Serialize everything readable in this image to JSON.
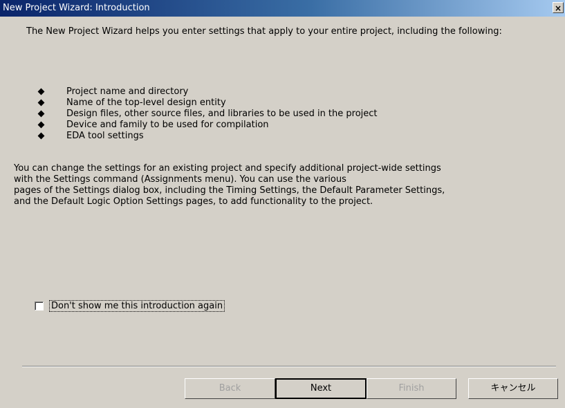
{
  "window": {
    "title": "New Project Wizard: Introduction",
    "close_glyph": "×"
  },
  "intro": {
    "text": "The New Project Wizard helps you enter settings that apply to your entire project, including the following:"
  },
  "bullets": [
    "Project name and directory",
    "Name of the top-level design entity",
    "Design files, other source files, and libraries to be used in the project",
    "Device and family to be used for compilation",
    "EDA tool settings"
  ],
  "description": {
    "lines": [
      "You can change the settings for an existing project and specify additional project-wide settings",
      "with the Settings command (Assignments menu).  You can use the various",
      "pages of the Settings dialog box, including the Timing Settings, the Default Parameter Settings,",
      "and the Default Logic Option Settings pages, to add functionality to the project."
    ]
  },
  "checkbox": {
    "label": "Don't show me this introduction again",
    "checked": false
  },
  "buttons": {
    "back": "Back",
    "next": "Next",
    "finish": "Finish",
    "cancel": "キャンセル"
  }
}
